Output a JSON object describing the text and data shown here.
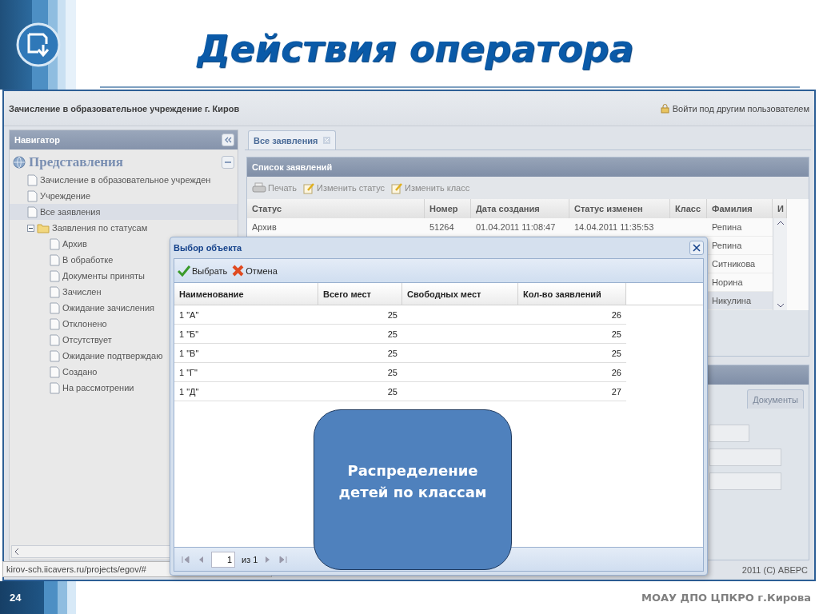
{
  "slide": {
    "title": "Действия оператора",
    "page_number": "24",
    "footer": "МОАУ ДПО ЦПКРО г.Кирова"
  },
  "app": {
    "title": "Зачисление в образовательное учреждение г. Киров",
    "login": "Войти под другим пользователем",
    "copyright": "2011 (С) АВЕРС",
    "status_url": "kirov-sch.iicavers.ru/projects/egov/#"
  },
  "navigator": {
    "title": "Навигатор",
    "section": "Представления",
    "tree": [
      {
        "label": "Зачисление в образовательное учрежден",
        "selected": false
      },
      {
        "label": "Учреждение",
        "selected": false
      },
      {
        "label": "Все заявления",
        "selected": true
      },
      {
        "label": "Заявления по статусам",
        "selected": false,
        "expanded": true,
        "children": [
          {
            "label": "Архив",
            "selected": false
          },
          {
            "label": "В обработке",
            "selected": false
          },
          {
            "label": "Документы приняты",
            "selected": false
          },
          {
            "label": "Зачислен",
            "selected": false
          },
          {
            "label": "Ожидание зачисления",
            "selected": false
          },
          {
            "label": "Отклонено",
            "selected": false
          },
          {
            "label": "Отсутствует",
            "selected": false
          },
          {
            "label": "Ожидание подтверждаю",
            "selected": false
          },
          {
            "label": "Создано",
            "selected": false
          },
          {
            "label": "На рассмотрении",
            "selected": false
          }
        ]
      }
    ]
  },
  "main": {
    "tabs": [
      {
        "label": "Все заявления",
        "selected": true
      }
    ],
    "panel_title": "Список заявлений",
    "toolbar": [
      {
        "kind": "print",
        "label": "Печать",
        "disabled": true
      },
      {
        "kind": "edit",
        "label": "Изменить статус",
        "disabled": true
      },
      {
        "kind": "edit",
        "label": "Изменить класс",
        "disabled": true
      }
    ],
    "columns": [
      "Статус",
      "Номер",
      "Дата создания",
      "Статус изменен",
      "Класс",
      "Фамилия",
      "И"
    ],
    "rows": [
      {
        "cells": [
          "Архив",
          "51264",
          "01.04.2011 11:08:47",
          "14.04.2011 11:35:53",
          "",
          "Репина"
        ],
        "selected": false
      },
      {
        "cells": [
          "",
          "",
          "",
          "",
          "",
          "Репина"
        ],
        "selected": false
      },
      {
        "cells": [
          "",
          "",
          "",
          "",
          "",
          "Ситникова"
        ],
        "selected": false
      },
      {
        "cells": [
          "",
          "",
          "",
          "",
          "",
          "Норина"
        ],
        "selected": false
      },
      {
        "cells": [
          "",
          "",
          "",
          "",
          "",
          "Никулина"
        ],
        "selected": true
      }
    ],
    "detail_tabs": [
      {
        "label": "Документы",
        "selected": false
      }
    ]
  },
  "dialog": {
    "title": "Выбор объекта",
    "buttons": [
      {
        "kind": "ok",
        "label": "Выбрать"
      },
      {
        "kind": "cancel",
        "label": "Отмена"
      }
    ],
    "columns": [
      "Наименование",
      "Всего мест",
      "Свободных мест",
      "Кол-во заявлений"
    ],
    "rows": [
      [
        "1 \"А\"",
        "25",
        "",
        "26"
      ],
      [
        "1 \"Б\"",
        "25",
        "",
        "25"
      ],
      [
        "1 \"В\"",
        "25",
        "",
        "25"
      ],
      [
        "1 \"Г\"",
        "25",
        "",
        "26"
      ],
      [
        "1 \"Д\"",
        "25",
        "",
        "27"
      ]
    ],
    "pager": {
      "page": "1",
      "of": "из 1"
    }
  },
  "callout": "Распределение детей по классам"
}
